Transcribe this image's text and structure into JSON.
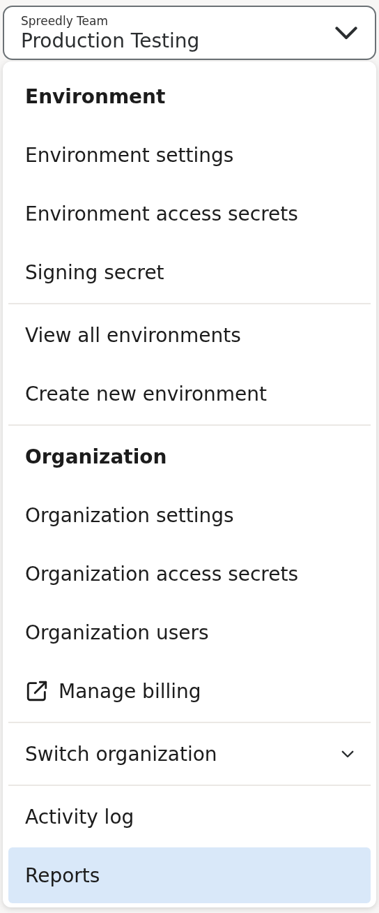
{
  "selector": {
    "label": "Spreedly Team",
    "value": "Production Testing"
  },
  "menu": {
    "sections": [
      {
        "items": [
          {
            "kind": "header",
            "label": "Environment"
          },
          {
            "kind": "link",
            "label": "Environment settings",
            "selected": false
          },
          {
            "kind": "link",
            "label": "Environment access secrets",
            "selected": false
          },
          {
            "kind": "link",
            "label": "Signing secret",
            "selected": false
          }
        ]
      },
      {
        "items": [
          {
            "kind": "link",
            "label": "View all environments",
            "selected": false
          },
          {
            "kind": "link",
            "label": "Create new environment",
            "selected": false
          }
        ]
      },
      {
        "items": [
          {
            "kind": "header",
            "label": "Organization"
          },
          {
            "kind": "link",
            "label": "Organization settings",
            "selected": false
          },
          {
            "kind": "link",
            "label": "Organization access secrets",
            "selected": false
          },
          {
            "kind": "link",
            "label": "Organization users",
            "selected": false
          },
          {
            "kind": "external",
            "label": "Manage billing",
            "selected": false
          }
        ]
      },
      {
        "items": [
          {
            "kind": "expandable",
            "label": "Switch organization",
            "expanded": false,
            "selected": false
          }
        ]
      },
      {
        "items": [
          {
            "kind": "link",
            "label": "Activity log",
            "selected": false
          },
          {
            "kind": "link",
            "label": "Reports",
            "selected": true
          }
        ]
      }
    ]
  }
}
